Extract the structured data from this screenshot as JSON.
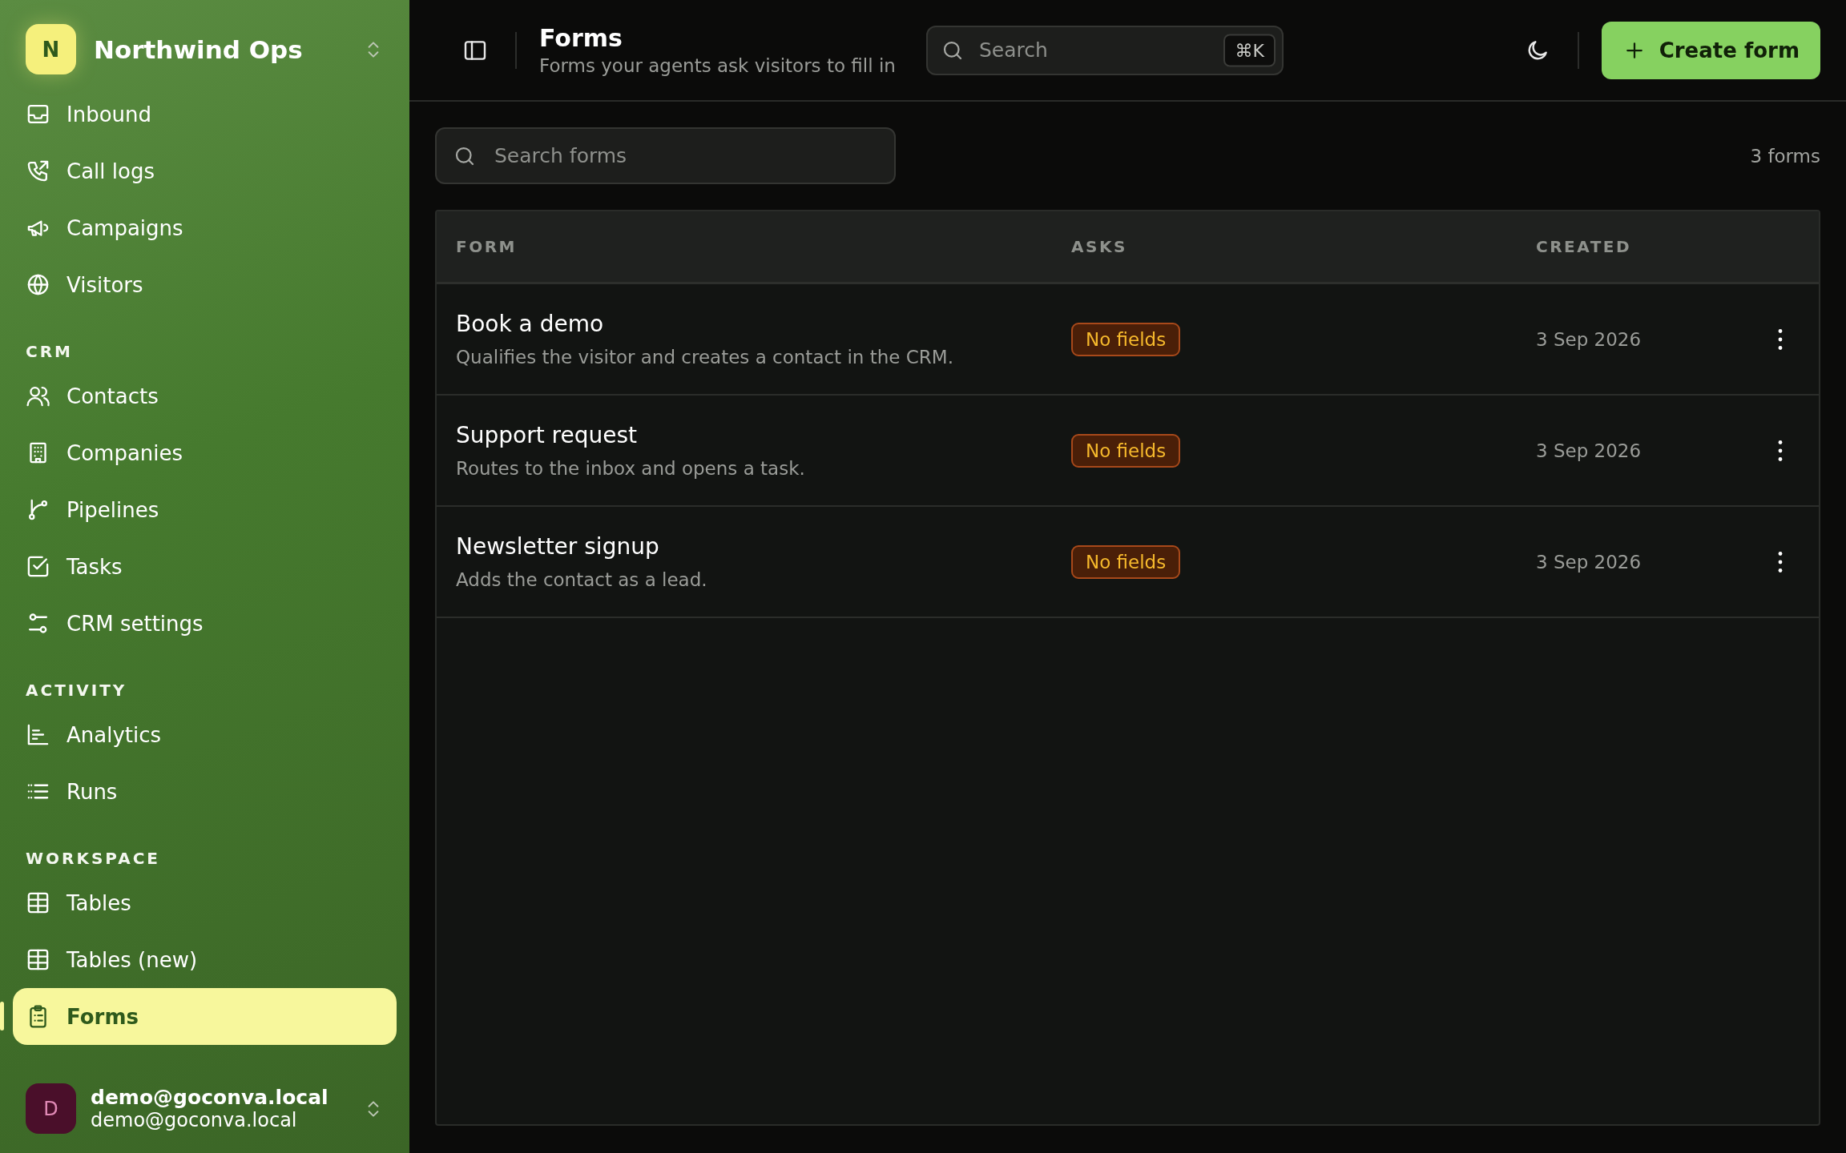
{
  "workspace": {
    "initial": "N",
    "name": "Northwind Ops"
  },
  "nav": [
    {
      "kind": "item",
      "label": "Inbound",
      "selected": false
    },
    {
      "kind": "item",
      "label": "Call logs",
      "selected": false
    },
    {
      "kind": "item",
      "label": "Campaigns",
      "selected": false
    },
    {
      "kind": "item",
      "label": "Visitors",
      "selected": false
    },
    {
      "kind": "section",
      "label": "CRM"
    },
    {
      "kind": "item",
      "label": "Contacts",
      "selected": false
    },
    {
      "kind": "item",
      "label": "Companies",
      "selected": false
    },
    {
      "kind": "item",
      "label": "Pipelines",
      "selected": false
    },
    {
      "kind": "item",
      "label": "Tasks",
      "selected": false
    },
    {
      "kind": "item",
      "label": "CRM settings",
      "selected": false
    },
    {
      "kind": "section",
      "label": "ACTIVITY"
    },
    {
      "kind": "item",
      "label": "Analytics",
      "selected": false
    },
    {
      "kind": "item",
      "label": "Runs",
      "selected": false
    },
    {
      "kind": "section",
      "label": "WORKSPACE"
    },
    {
      "kind": "item",
      "label": "Tables",
      "selected": false
    },
    {
      "kind": "item",
      "label": "Tables (new)",
      "selected": false
    },
    {
      "kind": "item",
      "label": "Forms",
      "selected": true
    }
  ],
  "user": {
    "initial": "D",
    "name": "demo@goconva.local",
    "email": "demo@goconva.local"
  },
  "header": {
    "title": "Forms",
    "subtitle": "Forms your agents ask visitors to fill in",
    "search_placeholder": "Search",
    "shortcut": "⌘K",
    "create_button": "Create form"
  },
  "toolbar": {
    "search_placeholder": "Search forms",
    "count": "3 forms"
  },
  "table": {
    "columns": [
      "FORM",
      "ASKS",
      "CREATED"
    ],
    "rows": [
      {
        "name": "Book a demo",
        "description": "Qualifies the visitor and creates a contact in the CRM.",
        "asks": "No fields",
        "created": "3 Sep 2026"
      },
      {
        "name": "Support request",
        "description": "Routes to the inbox and opens a task.",
        "asks": "No fields",
        "created": "3 Sep 2026"
      },
      {
        "name": "Newsletter signup",
        "description": "Adds the contact as a lead.",
        "asks": "No fields",
        "created": "3 Sep 2026"
      }
    ]
  }
}
